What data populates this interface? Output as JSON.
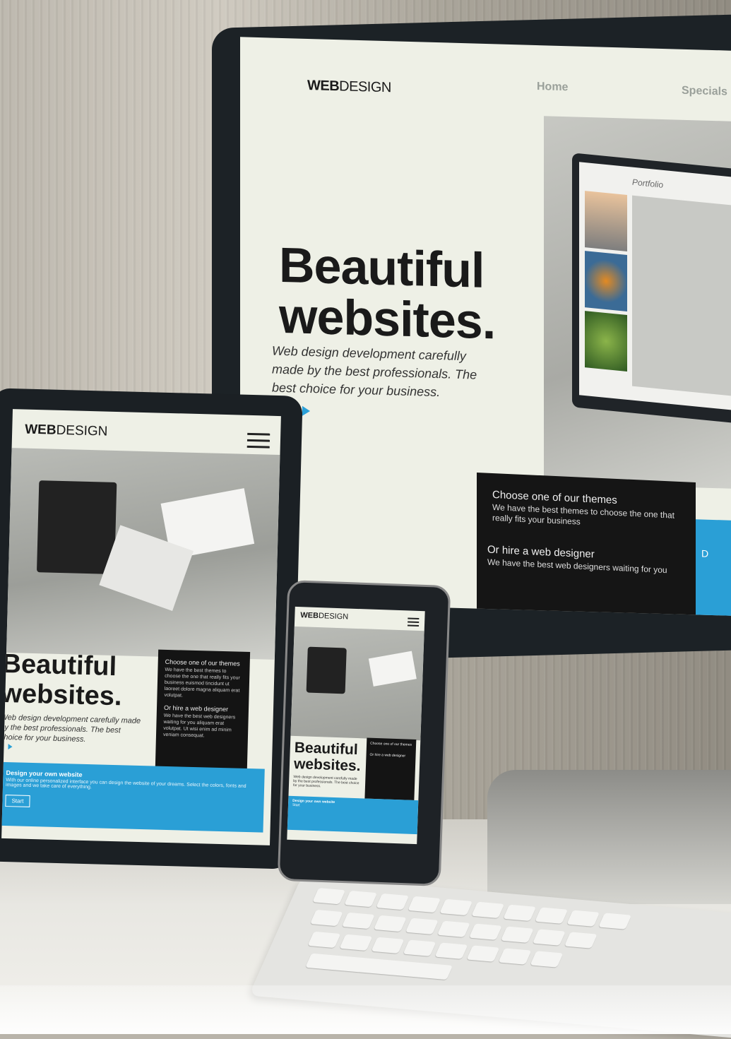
{
  "monitor": {
    "logo_bold": "WEB",
    "logo_light": "DESIGN",
    "nav": [
      "Home",
      "Specials"
    ],
    "hero_line1": "Beautiful",
    "hero_line2": "websites.",
    "subtitle": "Web design development carefully made by the best professionals. The best choice for your business.",
    "themes_title": "Choose one of our themes",
    "themes_text": "We have the best themes to choose the one that really fits your business",
    "designer_title": "Or hire a web designer",
    "designer_text": "We have the best web designers waiting for you",
    "blue_letter": "D",
    "portfolio_label": "Portfolio"
  },
  "tablet": {
    "logo_bold": "WEB",
    "logo_light": "DESIGN",
    "hero_line1": "Beautiful",
    "hero_line2": "websites.",
    "subtitle": "Web design development carefully made by the best professionals. The best choice for your business.",
    "themes_title": "Choose one of our themes",
    "themes_text": "We have the best themes to choose the one that really fits your business euismod tincidunt ut laoreet dolore magna aliquam erat volutpat.",
    "designer_title": "Or hire a web designer",
    "designer_text": "We have the best web designers waiting for you aliquam erat volutpat. Ut wisi enim ad minim veniam consequat.",
    "blue_title": "Design your own website",
    "blue_text": "With our online personalized interface you can design the website of your dreams. Select the colors, fonts and images and we take care of everything.",
    "blue_button": "Start"
  },
  "phone": {
    "logo_bold": "WEB",
    "logo_light": "DESIGN",
    "hero_line1": "Beautiful",
    "hero_line2": "websites.",
    "subtitle": "Web design development carefully made by the best professionals. The best choice for your business.",
    "themes_title": "Choose one of our themes",
    "designer_title": "Or hire a web designer",
    "blue_title": "Design your own website",
    "blue_button": "Start"
  },
  "colors": {
    "accent_blue": "#2a9fd6",
    "panel_black": "#151515",
    "screen_bg": "#eef0e6"
  }
}
